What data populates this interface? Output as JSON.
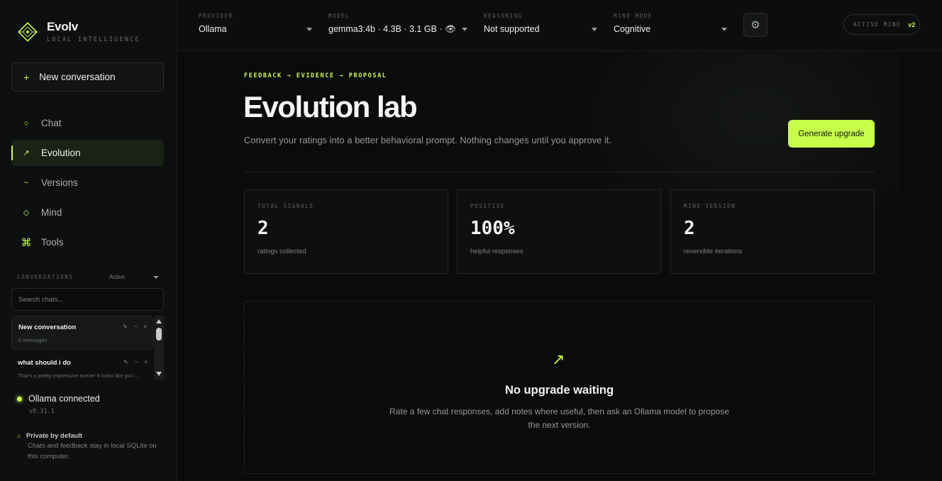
{
  "brand": {
    "name": "Evolv",
    "subtitle": "LOCAL INTELLIGENCE"
  },
  "sidebar": {
    "new_conversation": "New conversation",
    "nav": [
      {
        "label": "Chat",
        "icon": "circle-icon",
        "active": false
      },
      {
        "label": "Evolution",
        "icon": "arrow-up-right-icon",
        "active": true
      },
      {
        "label": "Versions",
        "icon": "tilde-icon",
        "active": false
      },
      {
        "label": "Mind",
        "icon": "diamond-icon",
        "active": false
      },
      {
        "label": "Tools",
        "icon": "command-icon",
        "active": false
      }
    ],
    "conversations_label": "CONVERSATIONS",
    "filter_value": "Active",
    "search_placeholder": "Search chats...",
    "conversations": [
      {
        "title": "New conversation",
        "meta": "0 messages"
      },
      {
        "title": "what should i do",
        "meta": "That's a pretty impressive scene! It looks like you'..."
      }
    ],
    "status": {
      "text": "Ollama connected",
      "version": "v0.31.1"
    },
    "privacy": {
      "title": "Private by default",
      "desc": "Chats and feedback stay in local SQLite on this computer."
    }
  },
  "topbar": {
    "provider": {
      "label": "PROVIDER",
      "value": "Ollama"
    },
    "model": {
      "label": "MODEL",
      "value": "gemma3:4b · 4.3B · 3.1 GB · 👁"
    },
    "reasoning": {
      "label": "REASONING",
      "value": "Not supported"
    },
    "mind_mode": {
      "label": "MIND MODE",
      "value": "Cognitive"
    },
    "active_mind": {
      "label": "ACTIVE MIND",
      "value": "v2"
    }
  },
  "main": {
    "eyebrow": "FEEDBACK → EVIDENCE → PROPOSAL",
    "title": "Evolution lab",
    "subtitle": "Convert your ratings into a better behavioral prompt. Nothing changes until you approve it.",
    "generate_button": "Generate upgrade",
    "stats": [
      {
        "label": "TOTAL SIGNALS",
        "value": "2",
        "desc": "ratings collected"
      },
      {
        "label": "POSITIVE",
        "value": "100%",
        "desc": "helpful responses"
      },
      {
        "label": "MIND VERSION",
        "value": "2",
        "desc": "reversible iterations"
      }
    ],
    "empty": {
      "title": "No upgrade waiting",
      "desc": "Rate a few chat responses, add notes where useful, then ask an Ollama model to propose the next version."
    }
  },
  "colors": {
    "accent": "#c8ff4a",
    "background": "#0b0c0c",
    "sidebar": "#0e0f0f"
  }
}
